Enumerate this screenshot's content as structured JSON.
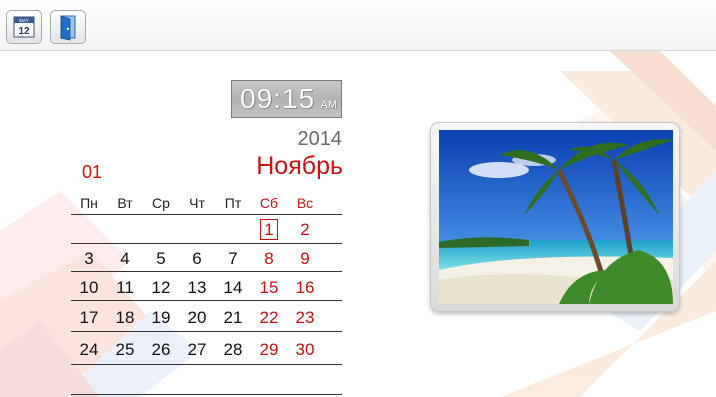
{
  "toolbar": {
    "calendar_icon": {
      "month_text": "MAY",
      "day_text": "12"
    },
    "exit_icon": "door-icon"
  },
  "clock": {
    "time": "09:15",
    "ampm": "AM"
  },
  "calendar": {
    "year": "2014",
    "day": "01",
    "month": "Ноябрь",
    "weekdays": [
      "Пн",
      "Вт",
      "Ср",
      "Чт",
      "Пт",
      "Сб",
      "Вс"
    ],
    "weeks": [
      [
        "",
        "",
        "",
        "",
        "",
        "1",
        "2"
      ],
      [
        "3",
        "4",
        "5",
        "6",
        "7",
        "8",
        "9"
      ],
      [
        "10",
        "11",
        "12",
        "13",
        "14",
        "15",
        "16"
      ],
      [
        "17",
        "18",
        "19",
        "20",
        "21",
        "22",
        "23"
      ],
      [
        "24",
        "25",
        "26",
        "27",
        "28",
        "29",
        "30"
      ],
      [
        "",
        "",
        "",
        "",
        "",
        "",
        ""
      ]
    ],
    "selected_day": "1"
  },
  "photo": {
    "subject": "tropical beach with palm trees"
  },
  "colors": {
    "accent": "#cc1111",
    "text": "#111111",
    "year": "#6a6a6a"
  }
}
